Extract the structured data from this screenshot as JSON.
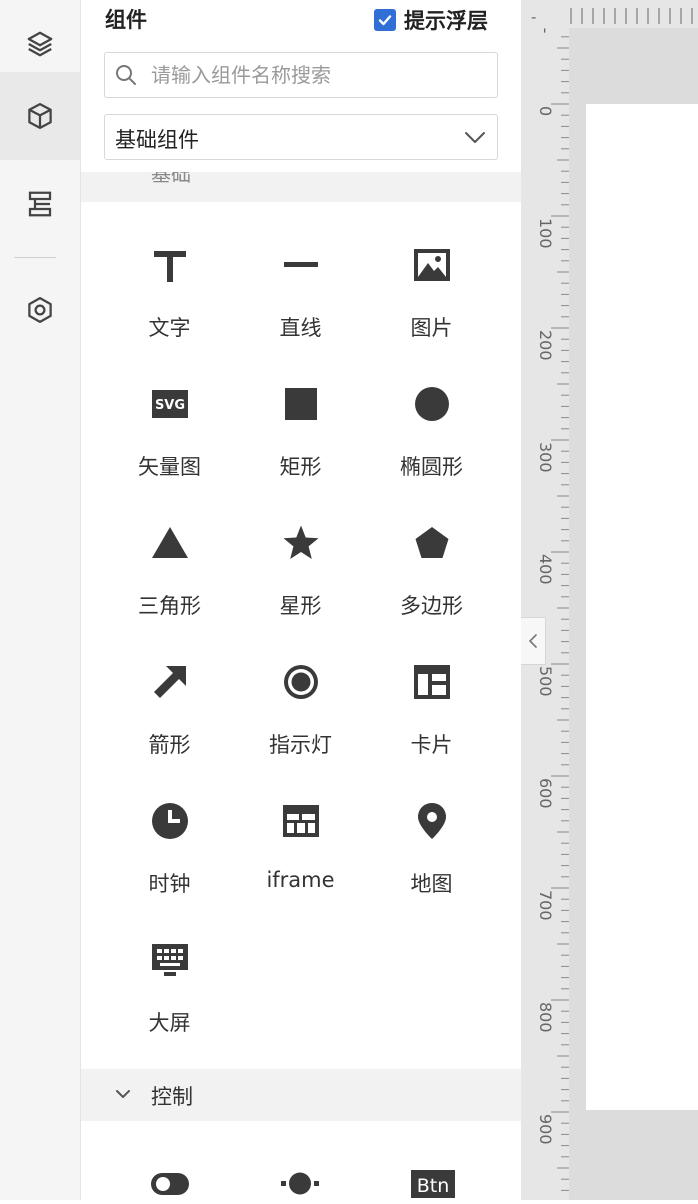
{
  "panel": {
    "title": "组件",
    "tooltip_toggle": {
      "label": "提示浮层",
      "checked": true
    },
    "search": {
      "placeholder": "请输入组件名称搜索",
      "value": ""
    },
    "category": {
      "selected": "基础组件"
    },
    "cut_section_title": "基础"
  },
  "components": [
    {
      "label": "文字",
      "icon": "text-icon"
    },
    {
      "label": "直线",
      "icon": "line-icon"
    },
    {
      "label": "图片",
      "icon": "image-icon"
    },
    {
      "label": "矢量图",
      "icon": "svg-icon",
      "icon_text": "SVG"
    },
    {
      "label": "矩形",
      "icon": "rectangle-icon"
    },
    {
      "label": "椭圆形",
      "icon": "ellipse-icon"
    },
    {
      "label": "三角形",
      "icon": "triangle-icon"
    },
    {
      "label": "星形",
      "icon": "star-icon"
    },
    {
      "label": "多边形",
      "icon": "polygon-icon"
    },
    {
      "label": "箭形",
      "icon": "arrow-icon"
    },
    {
      "label": "指示灯",
      "icon": "indicator-light-icon"
    },
    {
      "label": "卡片",
      "icon": "card-icon"
    },
    {
      "label": "时钟",
      "icon": "clock-icon"
    },
    {
      "label": "iframe",
      "icon": "iframe-icon"
    },
    {
      "label": "地图",
      "icon": "map-pin-icon"
    },
    {
      "label": "大屏",
      "icon": "big-screen-icon"
    }
  ],
  "control_section": {
    "title": "控制",
    "items": [
      {
        "icon": "switch-icon"
      },
      {
        "icon": "slider-icon"
      },
      {
        "icon": "button-icon",
        "icon_text": "Btn"
      }
    ]
  },
  "ruler": {
    "top_labels": [
      "-"
    ],
    "left_labels": [
      "-",
      "0",
      "100",
      "200",
      "300",
      "400",
      "500",
      "600",
      "700",
      "800",
      "900"
    ]
  },
  "colors": {
    "accent": "#2f6fd6",
    "icon": "#3a3a3a",
    "rail_bg": "#f5f5f5",
    "ruler_bg": "#e6e6e6"
  }
}
